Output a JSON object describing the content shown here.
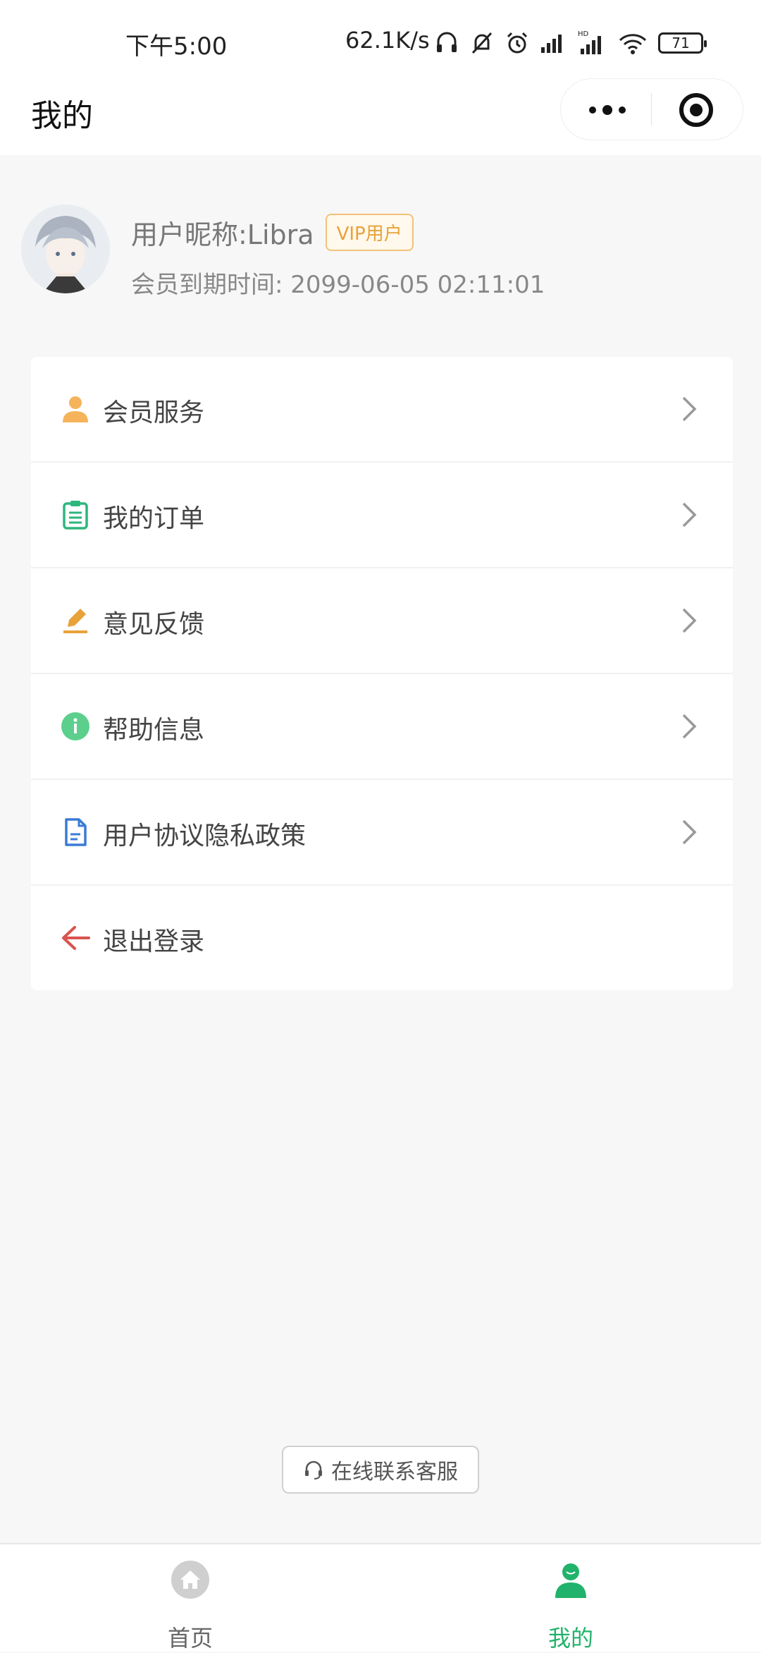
{
  "status_bar": {
    "time": "下午5:00",
    "net_speed": "62.1K/s",
    "battery": "71"
  },
  "header": {
    "title": "我的"
  },
  "profile": {
    "nickname": "用户昵称:Libra",
    "badge": "VIP用户",
    "expiry": "会员到期时间: 2099-06-05 02:11:01"
  },
  "menu": {
    "items": [
      {
        "label": "会员服务",
        "icon": "person-icon",
        "color": "#f5b45b"
      },
      {
        "label": "我的订单",
        "icon": "clipboard-icon",
        "color": "#2eb67d"
      },
      {
        "label": "意见反馈",
        "icon": "edit-icon",
        "color": "#e8a23a"
      },
      {
        "label": "帮助信息",
        "icon": "info-icon",
        "color": "#5ccf8d"
      },
      {
        "label": "用户协议隐私政策",
        "icon": "document-icon",
        "color": "#3a7bd5"
      },
      {
        "label": "退出登录",
        "icon": "arrow-left-icon",
        "color": "#d9534f"
      }
    ]
  },
  "support": {
    "label": "在线联系客服"
  },
  "tabbar": {
    "tabs": [
      {
        "label": "首页",
        "active": false
      },
      {
        "label": "我的",
        "active": true
      }
    ],
    "active_color": "#21b36b",
    "inactive_color": "#666666"
  }
}
